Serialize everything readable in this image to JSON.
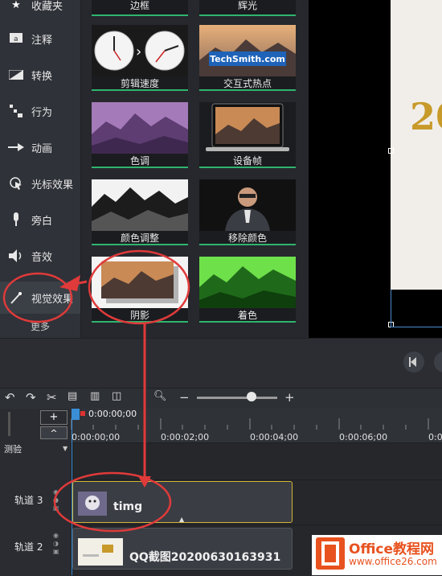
{
  "sidebar": {
    "items": [
      {
        "label": "收藏夹",
        "icon": "star-icon"
      },
      {
        "label": "注释",
        "icon": "annotation-icon"
      },
      {
        "label": "转换",
        "icon": "transition-icon"
      },
      {
        "label": "行为",
        "icon": "behavior-icon"
      },
      {
        "label": "动画",
        "icon": "animation-icon"
      },
      {
        "label": "光标效果",
        "icon": "cursor-icon"
      },
      {
        "label": "旁白",
        "icon": "microphone-icon"
      },
      {
        "label": "音效",
        "icon": "speaker-icon"
      },
      {
        "label": "视觉效果",
        "icon": "magic-wand-icon"
      }
    ],
    "more_label": "更多"
  },
  "effects": {
    "row0": [
      "边框",
      "辉光"
    ],
    "tiles": [
      "剪辑速度",
      "交互式热点",
      "色调",
      "设备帧",
      "颜色调整",
      "移除颜色",
      "阴影",
      "着色"
    ],
    "hotspot_text": "TechSmith.com"
  },
  "preview": {
    "gold_text": "20"
  },
  "timeline": {
    "zoom_minus": "−",
    "zoom_plus": "+",
    "add_track": "+",
    "collapse": "^",
    "playhead_time": "0:00:00;00",
    "ticks": [
      "0:00:00;00",
      "0:00:02;00",
      "0:00:04;00",
      "0:00:06;00",
      "0:00"
    ],
    "group_label": "测验",
    "tracks": [
      {
        "label": "轨道 3",
        "clip": "timg"
      },
      {
        "label": "轨道 2",
        "clip": "QQ截图20200630163931"
      }
    ]
  },
  "watermark": {
    "title": "Office教程网",
    "url": "www.office26.com"
  }
}
